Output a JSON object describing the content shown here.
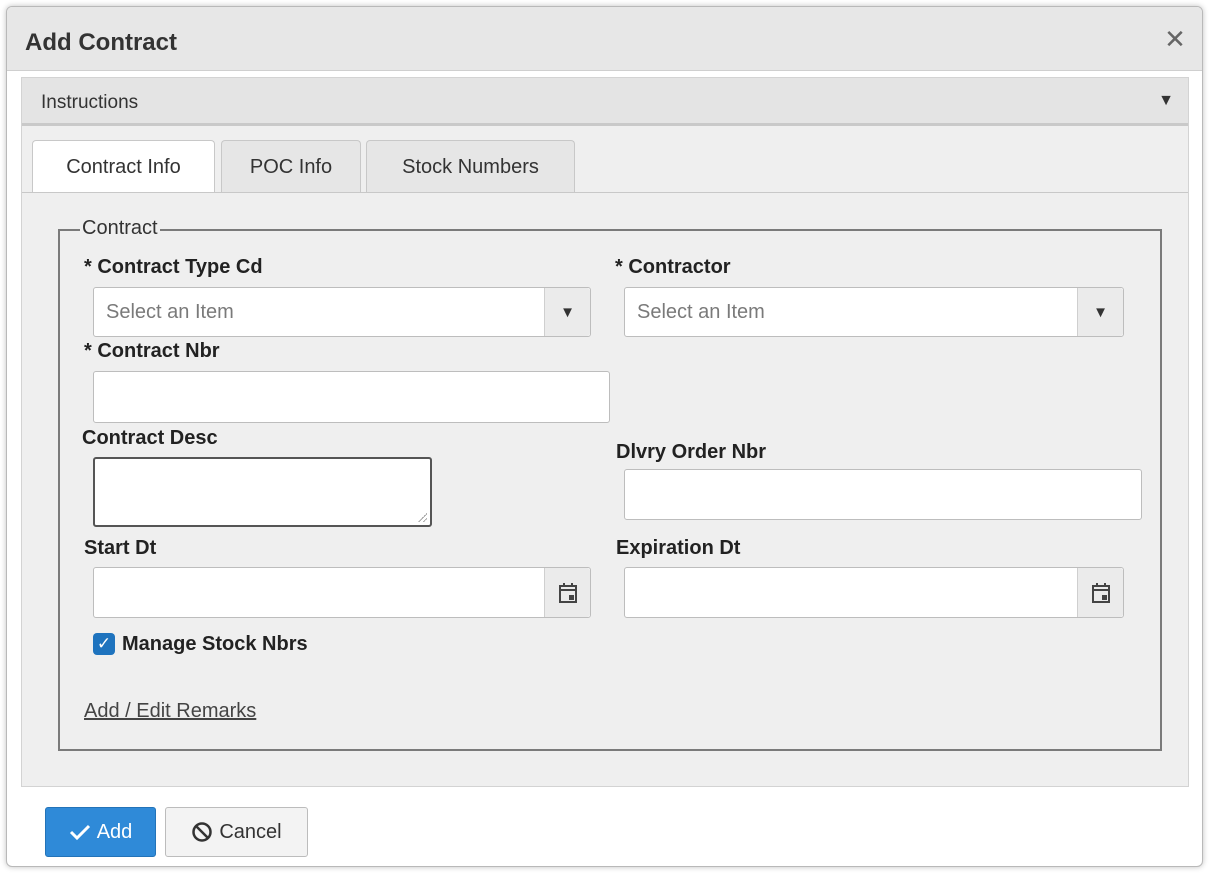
{
  "dialog": {
    "title": "Add Contract",
    "close_icon": "close-icon"
  },
  "instructions": {
    "label": "Instructions",
    "toggle_icon": "caret-down-icon"
  },
  "tabs": [
    {
      "label": "Contract Info",
      "active": true
    },
    {
      "label": "POC Info",
      "active": false
    },
    {
      "label": "Stock Numbers",
      "active": false
    }
  ],
  "form": {
    "legend": "Contract",
    "contract_type": {
      "label": "* Contract Type Cd",
      "placeholder": "Select an Item"
    },
    "contractor": {
      "label": "* Contractor",
      "placeholder": "Select an Item"
    },
    "contract_nbr": {
      "label": "* Contract Nbr",
      "value": ""
    },
    "contract_desc": {
      "label": "Contract Desc",
      "value": ""
    },
    "dlvry_order_nbr": {
      "label": "Dlvry Order Nbr",
      "value": ""
    },
    "start_dt": {
      "label": "Start Dt",
      "value": ""
    },
    "expiration_dt": {
      "label": "Expiration Dt",
      "value": ""
    },
    "manage_stock_nbrs": {
      "label": "Manage Stock Nbrs",
      "checked": true
    },
    "remarks_link": "Add / Edit Remarks"
  },
  "footer": {
    "add_label": "Add",
    "cancel_label": "Cancel"
  },
  "colors": {
    "primary": "#2f8ad8",
    "checkbox": "#1e73be"
  }
}
